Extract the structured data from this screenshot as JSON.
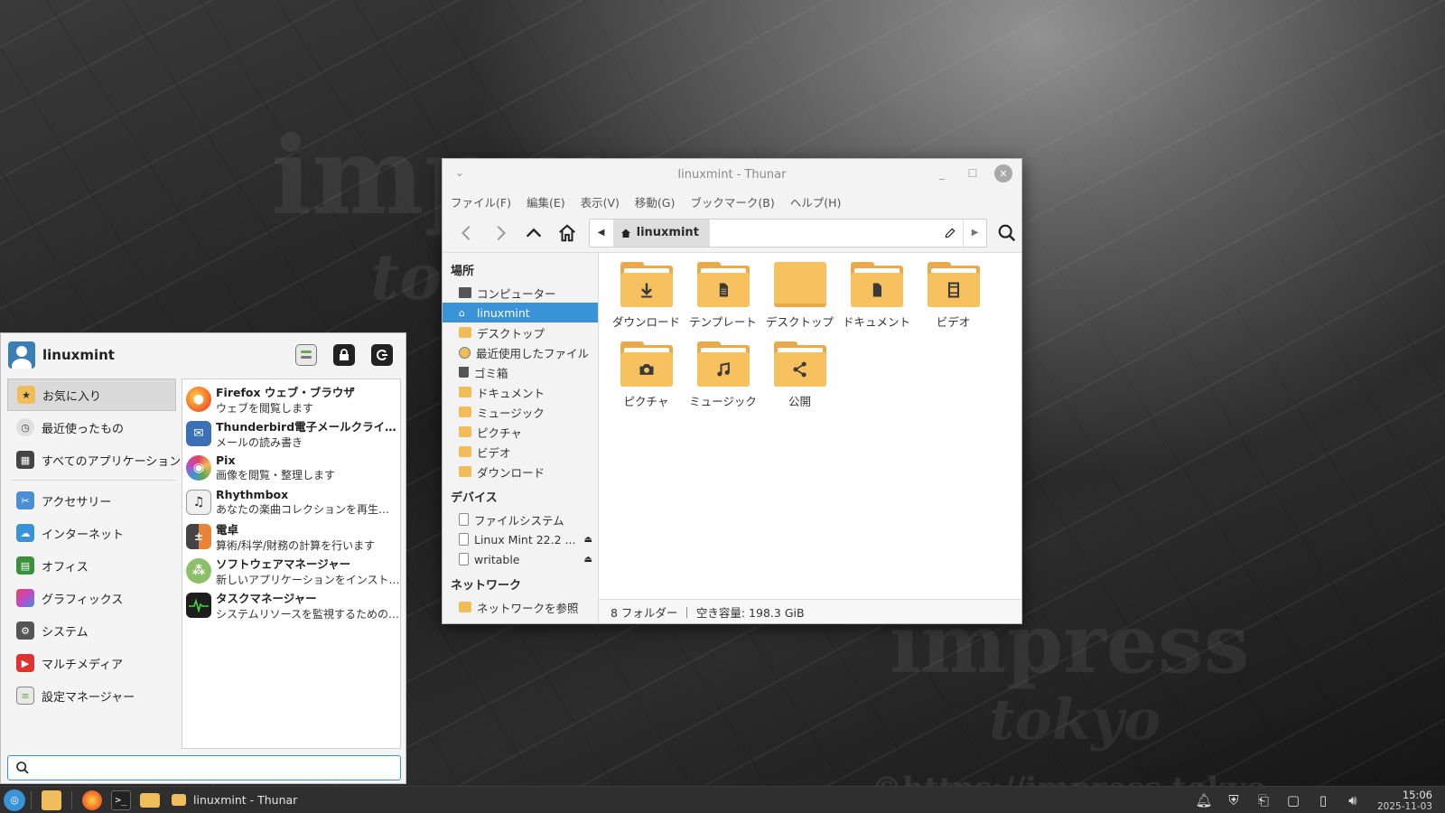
{
  "desktop": {
    "watermark_text": "impress tokyo ©https://impress.tokyo"
  },
  "thunar": {
    "title": "linuxmint - Thunar",
    "menu": [
      "ファイル(F)",
      "編集(E)",
      "表示(V)",
      "移動(G)",
      "ブックマーク(B)",
      "ヘルプ(H)"
    ],
    "path_current": "linuxmint",
    "sidebar": {
      "places_header": "場所",
      "places": [
        {
          "label": "コンピューター",
          "icon": "computer-icon"
        },
        {
          "label": "linuxmint",
          "icon": "home-icon",
          "selected": true
        },
        {
          "label": "デスクトップ",
          "icon": "folder-icon"
        },
        {
          "label": "最近使用したファイル",
          "icon": "recent-icon"
        },
        {
          "label": "ゴミ箱",
          "icon": "trash-icon"
        },
        {
          "label": "ドキュメント",
          "icon": "folder-icon"
        },
        {
          "label": "ミュージック",
          "icon": "folder-icon"
        },
        {
          "label": "ピクチャ",
          "icon": "folder-icon"
        },
        {
          "label": "ビデオ",
          "icon": "folder-icon"
        },
        {
          "label": "ダウンロード",
          "icon": "folder-icon"
        }
      ],
      "devices_header": "デバイス",
      "devices": [
        {
          "label": "ファイルシステム",
          "icon": "disk-icon",
          "eject": false
        },
        {
          "label": "Linux Mint 22.2 ...",
          "icon": "disk-icon",
          "eject": true
        },
        {
          "label": "writable",
          "icon": "disk-icon",
          "eject": true
        }
      ],
      "network_header": "ネットワーク",
      "network": [
        {
          "label": "ネットワークを参照",
          "icon": "folder-icon"
        }
      ]
    },
    "folders": [
      {
        "label": "ダウンロード",
        "emblem": "download"
      },
      {
        "label": "テンプレート",
        "emblem": "template"
      },
      {
        "label": "デスクトップ",
        "emblem": "desktop"
      },
      {
        "label": "ドキュメント",
        "emblem": "document"
      },
      {
        "label": "ビデオ",
        "emblem": "video"
      },
      {
        "label": "ピクチャ",
        "emblem": "camera"
      },
      {
        "label": "ミュージック",
        "emblem": "music"
      },
      {
        "label": "公開",
        "emblem": "share"
      }
    ],
    "status": "8 フォルダー ｜ 空き容量: 198.3 GiB"
  },
  "whisker": {
    "username": "linuxmint",
    "categories": [
      {
        "label": "お気に入り",
        "icon": "favorites-icon",
        "color": "#f1bd5b",
        "selected": true
      },
      {
        "label": "最近使ったもの",
        "icon": "recent-icon",
        "color": "#cfcfcf"
      },
      {
        "label": "すべてのアプリケーション",
        "icon": "all-apps-icon",
        "color": "#444444"
      },
      {
        "label": "アクセサリー",
        "icon": "accessories-icon",
        "color": "#4a8fd6"
      },
      {
        "label": "インターネット",
        "icon": "internet-icon",
        "color": "#3a93d6"
      },
      {
        "label": "オフィス",
        "icon": "office-icon",
        "color": "#3c8f3c"
      },
      {
        "label": "グラフィックス",
        "icon": "graphics-icon",
        "color": "#c04ac8"
      },
      {
        "label": "システム",
        "icon": "system-icon",
        "color": "#555555"
      },
      {
        "label": "マルチメディア",
        "icon": "multimedia-icon",
        "color": "#e03131"
      },
      {
        "label": "設定マネージャー",
        "icon": "settings-manager-icon",
        "color": "#6aa84f"
      }
    ],
    "apps": [
      {
        "name": "Firefox ウェブ・ブラウザ",
        "desc": "ウェブを閲覧します",
        "icon": "firefox-icon",
        "color": "#e8472b"
      },
      {
        "name": "Thunderbird電子メールクライアント",
        "desc": "メールの読み書き",
        "icon": "thunderbird-icon",
        "color": "#3b6fb6"
      },
      {
        "name": "Pix",
        "desc": "画像を閲覧・整理します",
        "icon": "pix-icon",
        "color": "#e6a23c"
      },
      {
        "name": "Rhythmbox",
        "desc": "あなたの楽曲コレクションを再生、整理します",
        "icon": "rhythmbox-icon",
        "color": "#333333"
      },
      {
        "name": "電卓",
        "desc": "算術/科学/財務の計算を行います",
        "icon": "calculator-icon",
        "color": "#444444"
      },
      {
        "name": "ソフトウェアマネージャー",
        "desc": "新しいアプリケーションをインストールします",
        "icon": "software-manager-icon",
        "color": "#6aa84f"
      },
      {
        "name": "タスクマネージャー",
        "desc": "システムリソースを監視するためのツール",
        "icon": "task-manager-icon",
        "color": "#1d1d1d"
      }
    ],
    "search_placeholder": ""
  },
  "taskbar": {
    "task_label": "linuxmint - Thunar",
    "time": "15:06",
    "date": "2025-11-03"
  }
}
